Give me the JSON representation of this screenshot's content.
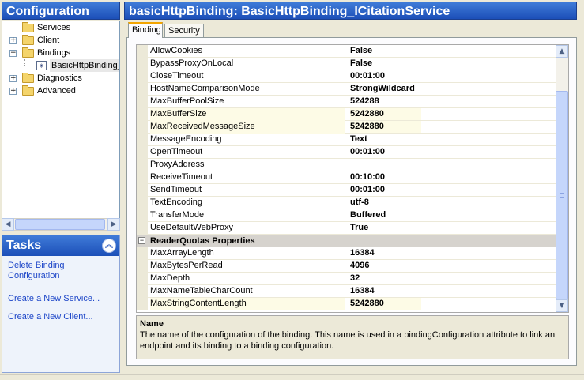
{
  "sidebar": {
    "title": "Configuration",
    "tree": [
      {
        "label": "Services"
      },
      {
        "label": "Client"
      },
      {
        "label": "Bindings"
      },
      {
        "label": "BasicHttpBinding_"
      },
      {
        "label": "Diagnostics"
      },
      {
        "label": "Advanced"
      }
    ]
  },
  "tasks": {
    "title": "Tasks",
    "items": [
      "Delete Binding Configuration",
      "Create a New Service...",
      "Create a New Client..."
    ]
  },
  "main": {
    "title": "basicHttpBinding: BasicHttpBinding_ICitationService",
    "tabs": [
      "Binding",
      "Security"
    ],
    "properties": [
      {
        "name": "AllowCookies",
        "value": "False"
      },
      {
        "name": "BypassProxyOnLocal",
        "value": "False"
      },
      {
        "name": "CloseTimeout",
        "value": "00:01:00"
      },
      {
        "name": "HostNameComparisonMode",
        "value": "StrongWildcard"
      },
      {
        "name": "MaxBufferPoolSize",
        "value": "524288"
      },
      {
        "name": "MaxBufferSize",
        "value": "5242880"
      },
      {
        "name": "MaxReceivedMessageSize",
        "value": "5242880"
      },
      {
        "name": "MessageEncoding",
        "value": "Text"
      },
      {
        "name": "OpenTimeout",
        "value": "00:01:00"
      },
      {
        "name": "ProxyAddress",
        "value": ""
      },
      {
        "name": "ReceiveTimeout",
        "value": "00:10:00"
      },
      {
        "name": "SendTimeout",
        "value": "00:01:00"
      },
      {
        "name": "TextEncoding",
        "value": "utf-8"
      },
      {
        "name": "TransferMode",
        "value": "Buffered"
      },
      {
        "name": "UseDefaultWebProxy",
        "value": "True"
      }
    ],
    "category": "ReaderQuotas Properties",
    "reader_quotas": [
      {
        "name": "MaxArrayLength",
        "value": "16384"
      },
      {
        "name": "MaxBytesPerRead",
        "value": "4096"
      },
      {
        "name": "MaxDepth",
        "value": "32"
      },
      {
        "name": "MaxNameTableCharCount",
        "value": "16384"
      },
      {
        "name": "MaxStringContentLength",
        "value": "5242880"
      }
    ],
    "description": {
      "title": "Name",
      "text": "The name of the configuration of the binding. This name is used in a bindingConfiguration attribute to link an endpoint and its binding to a binding configuration."
    }
  },
  "colors": {
    "header_blue": "#2a5fc6",
    "link_blue": "#1d46c8",
    "tab_accent": "#f3a500",
    "highlight_row": "#fdfbe6"
  }
}
